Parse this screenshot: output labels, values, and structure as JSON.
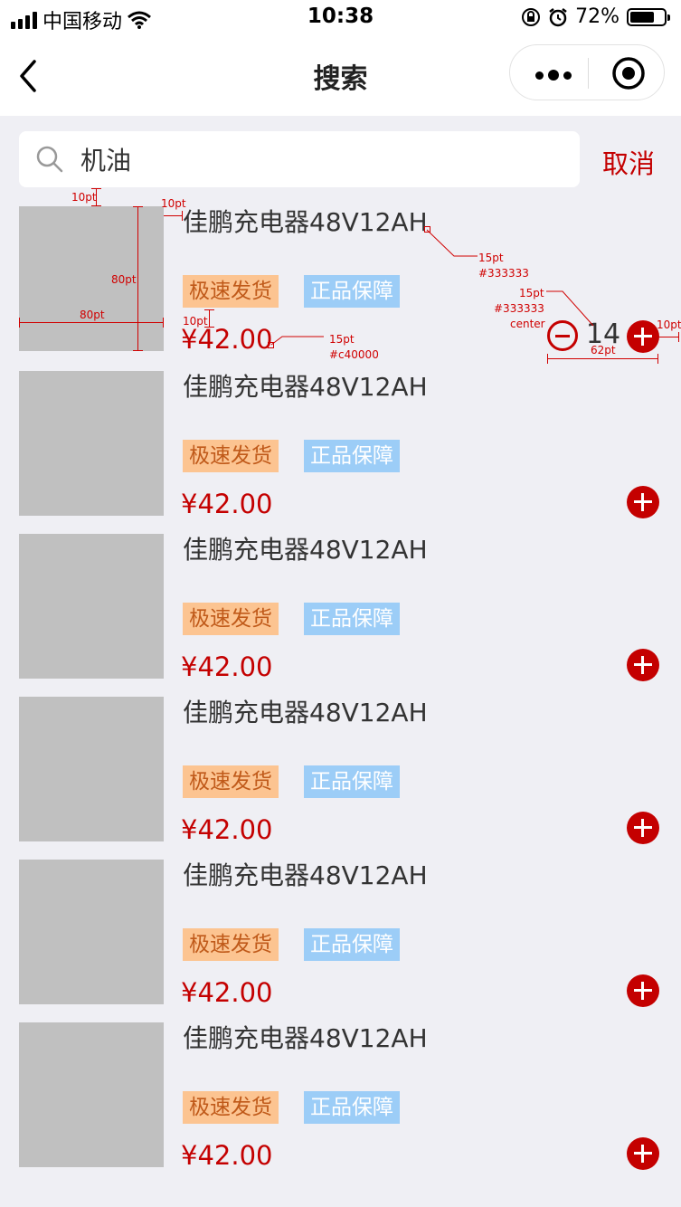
{
  "status_bar": {
    "carrier": "中国移动",
    "time": "10:38",
    "battery": "72%",
    "battery_level": 0.72
  },
  "nav": {
    "title": "搜索",
    "back_icon": "chevron-left-icon",
    "more_icon": "more-dots-icon",
    "close_icon": "target-circle-icon"
  },
  "search": {
    "value": "机油",
    "cancel_label": "取消",
    "icon": "search-icon"
  },
  "products": [
    {
      "name": "佳鹏充电器48V12AH",
      "tags": [
        "极速发货",
        "正品保障"
      ],
      "price": "¥42.00",
      "quantity": "14"
    },
    {
      "name": "佳鹏充电器48V12AH",
      "tags": [
        "极速发货",
        "正品保障"
      ],
      "price": "¥42.00"
    },
    {
      "name": "佳鹏充电器48V12AH",
      "tags": [
        "极速发货",
        "正品保障"
      ],
      "price": "¥42.00"
    },
    {
      "name": "佳鹏充电器48V12AH",
      "tags": [
        "极速发货",
        "正品保障"
      ],
      "price": "¥42.00"
    },
    {
      "name": "佳鹏充电器48V12AH",
      "tags": [
        "极速发货",
        "正品保障"
      ],
      "price": "¥42.00"
    },
    {
      "name": "佳鹏充电器48V12AH",
      "tags": [
        "极速发货",
        "正品保障"
      ],
      "price": "¥42.00"
    }
  ],
  "annotations": {
    "image_top_gap": "10pt",
    "image_text_gap": "10pt",
    "image_height": "80pt",
    "image_width": "80pt",
    "tag_price_gap": "10pt",
    "name_size": "15pt",
    "name_color": "#333333",
    "price_size": "15pt",
    "price_color": "#c40000",
    "qty_size": "15pt",
    "qty_color": "#333333",
    "qty_align": "center",
    "stepper_width": "62pt",
    "right_margin": "10pt"
  },
  "colors": {
    "accent": "#c40000",
    "text": "#333333",
    "tag_fast_bg": "#fcc491",
    "tag_genuine_bg": "#9ccdf7",
    "placeholder_image": "#c0c0c0",
    "page_bg": "#efeff4"
  }
}
